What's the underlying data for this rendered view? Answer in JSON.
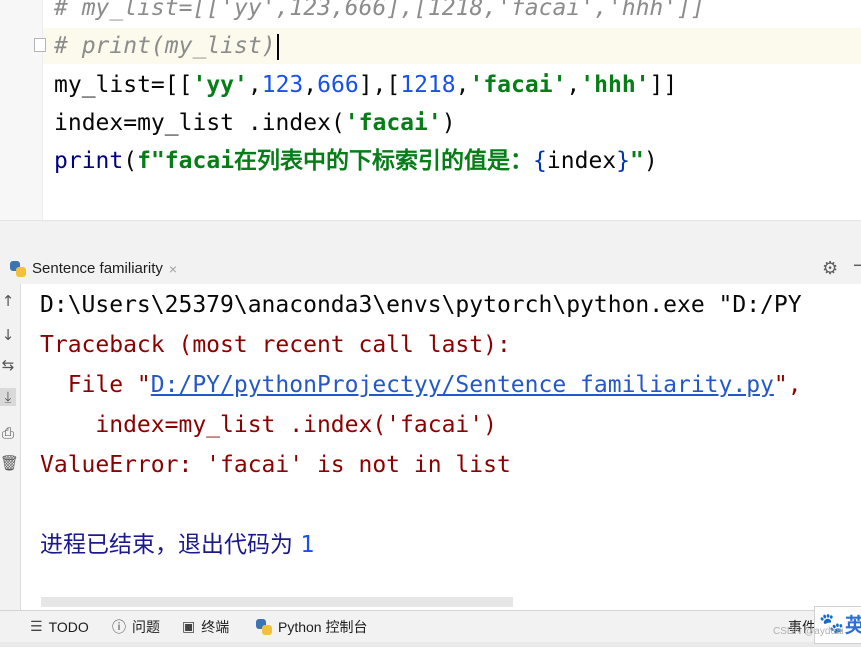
{
  "editor": {
    "line0": "# my_list=[['yy',123,666],[1218,'facai','hhh']]",
    "line1": "# print(my_list)",
    "line2": {
      "p1": "my_list=[[",
      "s1": "'yy'",
      "p2": ",",
      "n1": "123",
      "p3": ",",
      "n2": "666",
      "p4": "],[",
      "n3": "1218",
      "p5": ",",
      "s2": "'facai'",
      "p6": ",",
      "s3": "'hhh'",
      "p7": "]]"
    },
    "line3": {
      "p1": "index=my_list .index(",
      "s1": "'facai'",
      "p2": ")"
    },
    "line4": {
      "kw": "print",
      "p1": "(",
      "f": "f\"facai",
      "zh": "在列表中的下标索引的值是：",
      "b1": "{",
      "v": "index",
      "b2": "}",
      "q": "\"",
      "p2": ")"
    }
  },
  "run_panel": {
    "tab_label": "Sentence familiarity",
    "tab_close": "×"
  },
  "console": {
    "line1": "D:\\Users\\25379\\anaconda3\\envs\\pytorch\\python.exe \"D:/PY",
    "line2": "Traceback (most recent call last):",
    "line3_prefix": "  File \"",
    "line3_link": "D:/PY/pythonProjectyy/Sentence familiarity.py",
    "line3_suffix": "\",",
    "line4": "    index=my_list .index('facai')",
    "line5": "ValueError: 'facai' is not in list",
    "exit_text": "进程已结束，退出代码为 ",
    "exit_code": "1"
  },
  "bottom_bar": {
    "todo": "TODO",
    "problems": "问题",
    "terminal": "终端",
    "python_console": "Python 控制台",
    "events": "事件"
  },
  "badge": {
    "ying": "英"
  },
  "watermark": "CSDN @aydeai",
  "colors": {
    "comment": "#8c8c8c",
    "string": "#067d17",
    "number": "#1750eb",
    "error": "#8b0000",
    "link": "#2458c8"
  }
}
